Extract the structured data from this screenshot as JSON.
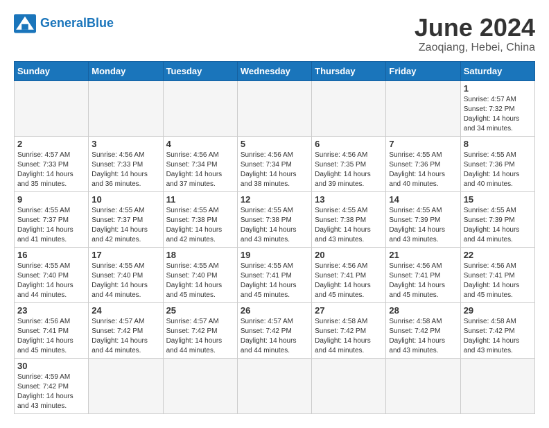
{
  "header": {
    "logo_general": "General",
    "logo_blue": "Blue",
    "month_title": "June 2024",
    "subtitle": "Zaoqiang, Hebei, China"
  },
  "weekdays": [
    "Sunday",
    "Monday",
    "Tuesday",
    "Wednesday",
    "Thursday",
    "Friday",
    "Saturday"
  ],
  "weeks": [
    [
      {
        "day": "",
        "info": ""
      },
      {
        "day": "",
        "info": ""
      },
      {
        "day": "",
        "info": ""
      },
      {
        "day": "",
        "info": ""
      },
      {
        "day": "",
        "info": ""
      },
      {
        "day": "",
        "info": ""
      },
      {
        "day": "1",
        "info": "Sunrise: 4:57 AM\nSunset: 7:32 PM\nDaylight: 14 hours\nand 34 minutes."
      }
    ],
    [
      {
        "day": "2",
        "info": "Sunrise: 4:57 AM\nSunset: 7:33 PM\nDaylight: 14 hours\nand 35 minutes."
      },
      {
        "day": "3",
        "info": "Sunrise: 4:56 AM\nSunset: 7:33 PM\nDaylight: 14 hours\nand 36 minutes."
      },
      {
        "day": "4",
        "info": "Sunrise: 4:56 AM\nSunset: 7:34 PM\nDaylight: 14 hours\nand 37 minutes."
      },
      {
        "day": "5",
        "info": "Sunrise: 4:56 AM\nSunset: 7:34 PM\nDaylight: 14 hours\nand 38 minutes."
      },
      {
        "day": "6",
        "info": "Sunrise: 4:56 AM\nSunset: 7:35 PM\nDaylight: 14 hours\nand 39 minutes."
      },
      {
        "day": "7",
        "info": "Sunrise: 4:55 AM\nSunset: 7:36 PM\nDaylight: 14 hours\nand 40 minutes."
      },
      {
        "day": "8",
        "info": "Sunrise: 4:55 AM\nSunset: 7:36 PM\nDaylight: 14 hours\nand 40 minutes."
      }
    ],
    [
      {
        "day": "9",
        "info": "Sunrise: 4:55 AM\nSunset: 7:37 PM\nDaylight: 14 hours\nand 41 minutes."
      },
      {
        "day": "10",
        "info": "Sunrise: 4:55 AM\nSunset: 7:37 PM\nDaylight: 14 hours\nand 42 minutes."
      },
      {
        "day": "11",
        "info": "Sunrise: 4:55 AM\nSunset: 7:38 PM\nDaylight: 14 hours\nand 42 minutes."
      },
      {
        "day": "12",
        "info": "Sunrise: 4:55 AM\nSunset: 7:38 PM\nDaylight: 14 hours\nand 43 minutes."
      },
      {
        "day": "13",
        "info": "Sunrise: 4:55 AM\nSunset: 7:38 PM\nDaylight: 14 hours\nand 43 minutes."
      },
      {
        "day": "14",
        "info": "Sunrise: 4:55 AM\nSunset: 7:39 PM\nDaylight: 14 hours\nand 43 minutes."
      },
      {
        "day": "15",
        "info": "Sunrise: 4:55 AM\nSunset: 7:39 PM\nDaylight: 14 hours\nand 44 minutes."
      }
    ],
    [
      {
        "day": "16",
        "info": "Sunrise: 4:55 AM\nSunset: 7:40 PM\nDaylight: 14 hours\nand 44 minutes."
      },
      {
        "day": "17",
        "info": "Sunrise: 4:55 AM\nSunset: 7:40 PM\nDaylight: 14 hours\nand 44 minutes."
      },
      {
        "day": "18",
        "info": "Sunrise: 4:55 AM\nSunset: 7:40 PM\nDaylight: 14 hours\nand 45 minutes."
      },
      {
        "day": "19",
        "info": "Sunrise: 4:55 AM\nSunset: 7:41 PM\nDaylight: 14 hours\nand 45 minutes."
      },
      {
        "day": "20",
        "info": "Sunrise: 4:56 AM\nSunset: 7:41 PM\nDaylight: 14 hours\nand 45 minutes."
      },
      {
        "day": "21",
        "info": "Sunrise: 4:56 AM\nSunset: 7:41 PM\nDaylight: 14 hours\nand 45 minutes."
      },
      {
        "day": "22",
        "info": "Sunrise: 4:56 AM\nSunset: 7:41 PM\nDaylight: 14 hours\nand 45 minutes."
      }
    ],
    [
      {
        "day": "23",
        "info": "Sunrise: 4:56 AM\nSunset: 7:41 PM\nDaylight: 14 hours\nand 45 minutes."
      },
      {
        "day": "24",
        "info": "Sunrise: 4:57 AM\nSunset: 7:42 PM\nDaylight: 14 hours\nand 44 minutes."
      },
      {
        "day": "25",
        "info": "Sunrise: 4:57 AM\nSunset: 7:42 PM\nDaylight: 14 hours\nand 44 minutes."
      },
      {
        "day": "26",
        "info": "Sunrise: 4:57 AM\nSunset: 7:42 PM\nDaylight: 14 hours\nand 44 minutes."
      },
      {
        "day": "27",
        "info": "Sunrise: 4:58 AM\nSunset: 7:42 PM\nDaylight: 14 hours\nand 44 minutes."
      },
      {
        "day": "28",
        "info": "Sunrise: 4:58 AM\nSunset: 7:42 PM\nDaylight: 14 hours\nand 43 minutes."
      },
      {
        "day": "29",
        "info": "Sunrise: 4:58 AM\nSunset: 7:42 PM\nDaylight: 14 hours\nand 43 minutes."
      }
    ],
    [
      {
        "day": "30",
        "info": "Sunrise: 4:59 AM\nSunset: 7:42 PM\nDaylight: 14 hours\nand 43 minutes."
      },
      {
        "day": "",
        "info": ""
      },
      {
        "day": "",
        "info": ""
      },
      {
        "day": "",
        "info": ""
      },
      {
        "day": "",
        "info": ""
      },
      {
        "day": "",
        "info": ""
      },
      {
        "day": "",
        "info": ""
      }
    ]
  ]
}
